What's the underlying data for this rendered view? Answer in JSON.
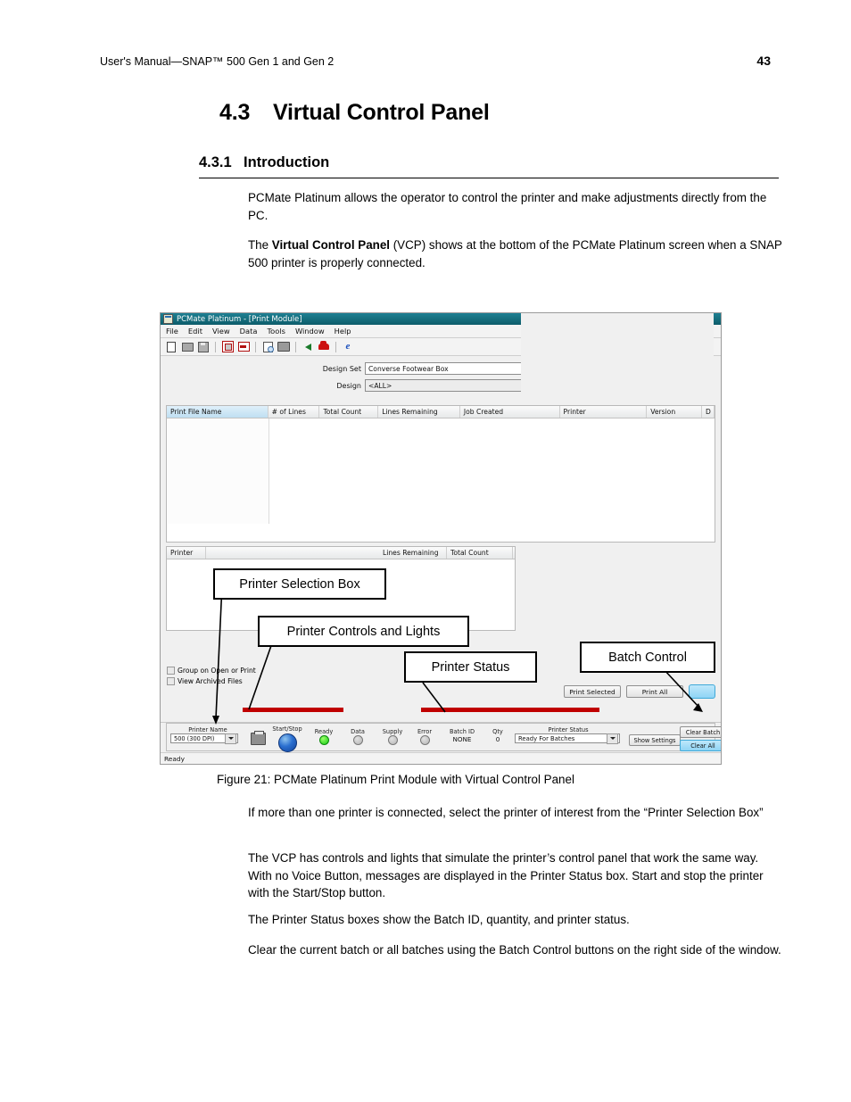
{
  "document": {
    "running_head": "User's Manual—SNAP™ 500 Gen 1 and Gen 2",
    "page_number": "43",
    "section_number": "4.3",
    "section_title": "Virtual Control Panel",
    "subsection_number": "4.3.1",
    "subsection_title": "Introduction",
    "paragraph_1": "PCMate Platinum allows the operator to control the printer and make adjustments directly from the PC.",
    "paragraph_2_pre": "The ",
    "paragraph_2_bold": "Virtual Control Panel",
    "paragraph_2_post": " (VCP) shows at the bottom of the PCMate Platinum screen when a SNAP 500 printer is properly connected.",
    "figure_caption": "Figure 21:  PCMate Platinum Print Module with Virtual Control Panel",
    "paragraph_3": "If more than one printer is connected, select the printer of interest from the “Printer Selection Box”",
    "paragraph_4": "The VCP has controls and lights that simulate the printer’s control panel that work the same way.  With no Voice Button, messages are displayed in the Printer Status box. Start and stop the printer with the Start/Stop button.",
    "paragraph_5": "The Printer Status boxes show the Batch ID, quantity, and printer status.",
    "paragraph_6": "Clear the current batch or all batches using the Batch Control buttons on the right side of the window."
  },
  "screenshot": {
    "titlebar": {
      "title": "PCMate Platinum - [Print Module]",
      "icon": "app-icon",
      "color": "#17707f"
    },
    "menu": [
      "File",
      "Edit",
      "View",
      "Data",
      "Tools",
      "Window",
      "Help"
    ],
    "toolbar_icons": [
      "new-document-icon",
      "open-folder-icon",
      "save-disk-icon",
      "grid-view-icon",
      "form-view-icon",
      "print-preview-icon",
      "print-icon",
      "green-arrow-icon",
      "red-car-icon",
      "internet-explorer-icon"
    ],
    "design": {
      "design_set_label": "Design Set",
      "design_set_value": "Converse Footwear Box",
      "design_label": "Design",
      "design_value": "<ALL>"
    },
    "file_grid": {
      "columns": [
        "Print File Name",
        "# of Lines",
        "Total Count",
        "Lines Remaining",
        "Job Created",
        "Printer",
        "Version",
        "D"
      ]
    },
    "printer_grid": {
      "columns": [
        "Printer",
        "Lines Remaining",
        "Total Count"
      ]
    },
    "checkboxes": [
      {
        "label": "Group on Open or Print",
        "checked": false
      },
      {
        "label": "View Archived Files",
        "checked": false
      }
    ],
    "print_buttons": [
      "Print Selected",
      "Print All"
    ],
    "vcp": {
      "printer_name_label": "Printer Name",
      "printer_name_value": "500 (300 DPI)",
      "printer_icon": "printer-icon",
      "start_stop_label": "Start/Stop",
      "lights": [
        {
          "label": "Ready",
          "state": "on"
        },
        {
          "label": "Data",
          "state": "off"
        },
        {
          "label": "Supply",
          "state": "off"
        },
        {
          "label": "Error",
          "state": "off"
        }
      ],
      "batch_id_label": "Batch ID",
      "batch_id_value": "NONE",
      "qty_label": "Qty",
      "qty_value": "0",
      "printer_status_label": "Printer Status",
      "printer_status_value": "Ready For Batches",
      "show_settings_label": "Show Settings",
      "clear_batch_label": "Clear Batch",
      "clear_all_label": "Clear All"
    },
    "statusbar": "Ready",
    "callouts": [
      {
        "label": "Printer Selection Box"
      },
      {
        "label": "Printer Controls and Lights"
      },
      {
        "label": "Printer Status"
      },
      {
        "label": "Batch Control"
      }
    ]
  }
}
